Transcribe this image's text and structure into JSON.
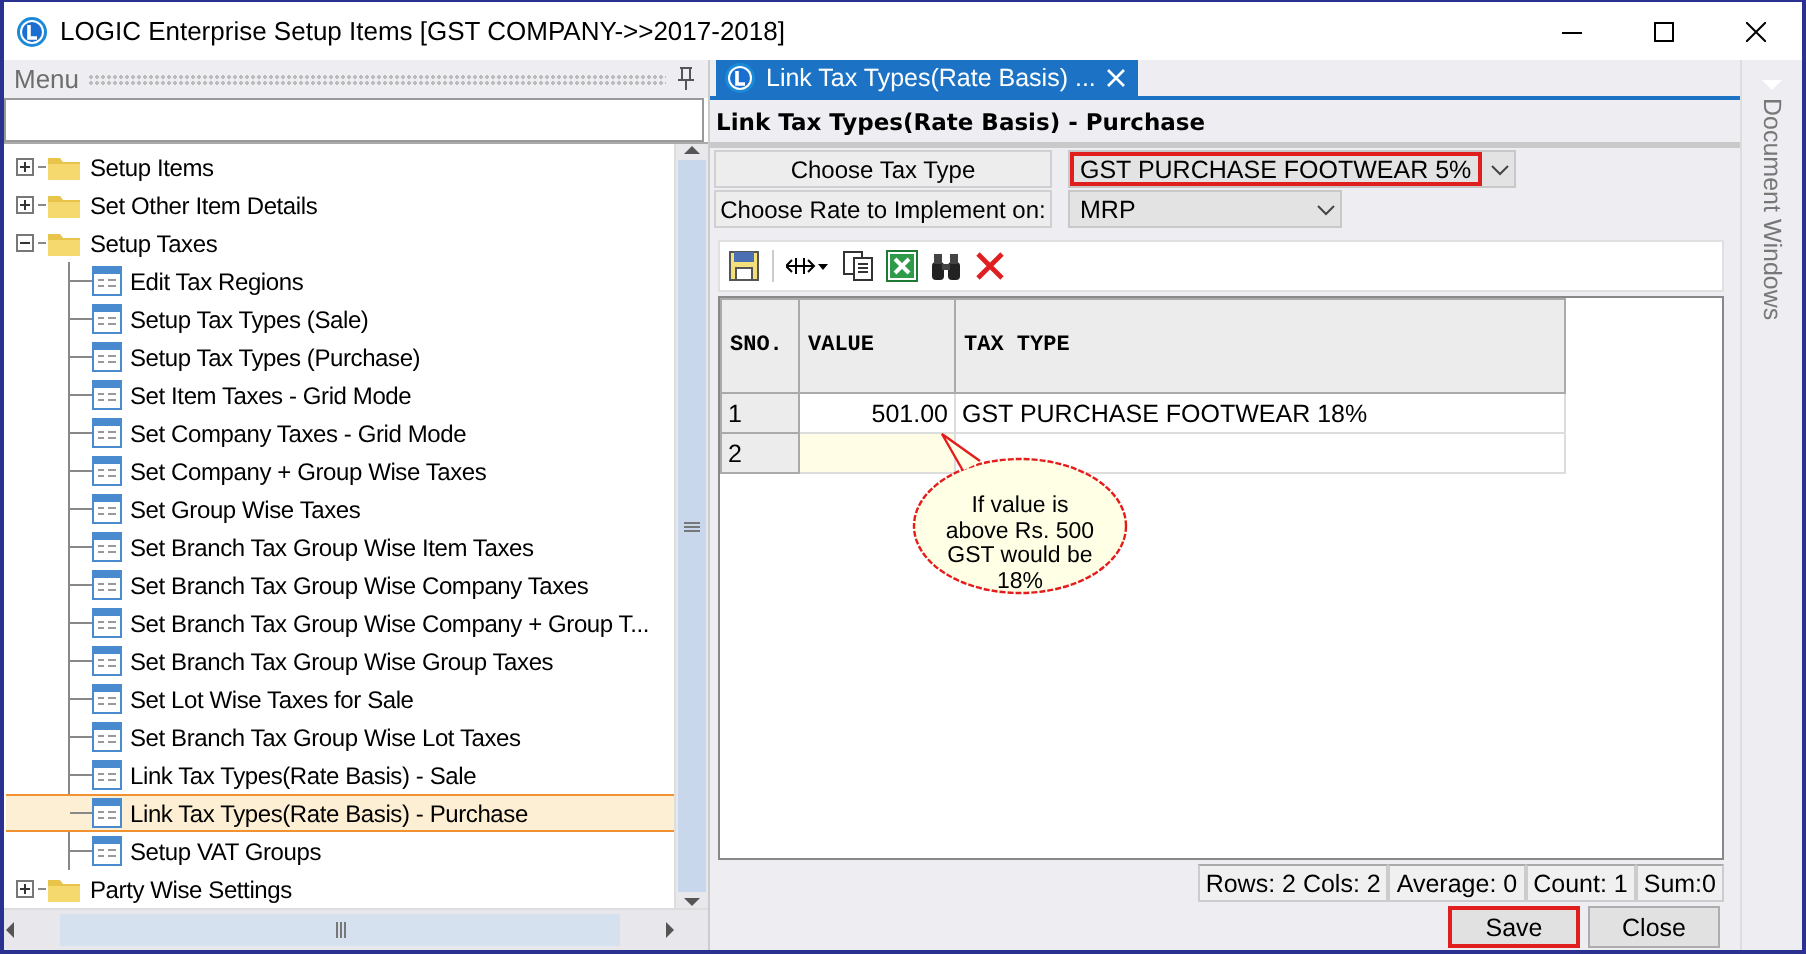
{
  "window": {
    "title": "LOGIC Enterprise Setup Items  [GST COMPANY->>2017-2018]"
  },
  "menu": {
    "title": "Menu",
    "tree": [
      {
        "label": "Setup Items",
        "kind": "folder",
        "expanded": false,
        "selected": false
      },
      {
        "label": "Set Other Item Details",
        "kind": "folder",
        "expanded": false,
        "selected": false
      },
      {
        "label": "Setup Taxes",
        "kind": "folder",
        "expanded": true,
        "selected": false,
        "children": [
          {
            "label": "Edit Tax Regions",
            "kind": "form",
            "selected": false
          },
          {
            "label": "Setup Tax Types (Sale)",
            "kind": "form",
            "selected": false
          },
          {
            "label": "Setup Tax Types (Purchase)",
            "kind": "form",
            "selected": false
          },
          {
            "label": "Set Item Taxes - Grid Mode",
            "kind": "form",
            "selected": false
          },
          {
            "label": "Set Company Taxes - Grid Mode",
            "kind": "form",
            "selected": false
          },
          {
            "label": "Set Company + Group Wise Taxes",
            "kind": "form",
            "selected": false
          },
          {
            "label": "Set Group Wise Taxes",
            "kind": "form",
            "selected": false
          },
          {
            "label": "Set Branch Tax Group Wise Item Taxes",
            "kind": "form",
            "selected": false
          },
          {
            "label": "Set Branch Tax Group Wise Company Taxes",
            "kind": "form",
            "selected": false
          },
          {
            "label": "Set Branch Tax Group Wise Company + Group T...",
            "kind": "form",
            "selected": false
          },
          {
            "label": "Set Branch Tax Group Wise Group Taxes",
            "kind": "form",
            "selected": false
          },
          {
            "label": "Set Lot Wise Taxes for Sale",
            "kind": "form",
            "selected": false
          },
          {
            "label": "Set Branch Tax Group Wise Lot Taxes",
            "kind": "form",
            "selected": false
          },
          {
            "label": "Link Tax Types(Rate Basis) - Sale",
            "kind": "form",
            "selected": false
          },
          {
            "label": "Link Tax Types(Rate Basis) - Purchase",
            "kind": "form",
            "selected": true
          },
          {
            "label": "Setup VAT Groups",
            "kind": "form",
            "selected": false
          }
        ]
      },
      {
        "label": "Party Wise Settings",
        "kind": "folder",
        "expanded": false,
        "selected": false
      }
    ]
  },
  "document_tab": {
    "title": "Link Tax Types(Rate Basis) ..."
  },
  "side_strip": {
    "label": "Document Windows"
  },
  "form": {
    "heading": "Link Tax Types(Rate Basis) - Purchase",
    "fields": [
      {
        "label": "Choose Tax Type",
        "value": "GST PURCHASE FOOTWEAR 5%",
        "highlighted": true
      },
      {
        "label": "Choose Rate to Implement on:",
        "value": "MRP",
        "highlighted": false
      }
    ]
  },
  "grid": {
    "columns": [
      "SNO.",
      "VALUE",
      "TAX TYPE"
    ],
    "rows": [
      {
        "sno": "1",
        "value": "501.00",
        "tax_type": "GST PURCHASE FOOTWEAR 18%",
        "selected": false
      },
      {
        "sno": "2",
        "selected": true
      }
    ]
  },
  "callout": {
    "text": "If value is above Rs. 500 GST would be 18%"
  },
  "status_bar": [
    "Rows: 2  Cols: 2",
    "Average: 0",
    "Count: 1",
    "Sum:0"
  ],
  "buttons": [
    {
      "label": "Save",
      "highlighted": true
    },
    {
      "label": "Close",
      "highlighted": false
    }
  ]
}
